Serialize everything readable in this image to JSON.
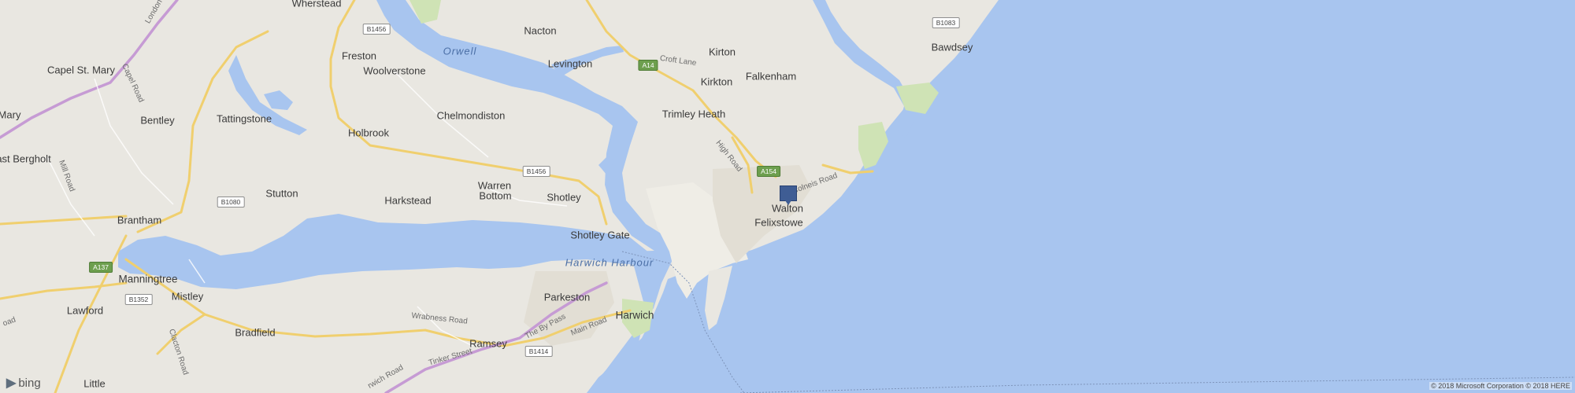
{
  "map": {
    "colors": {
      "land": "#e9e7e1",
      "water": "#a8c5ef",
      "main_road": "#f0cf6e",
      "trunk_road": "#c69bd4",
      "park": "#cfe3b5",
      "port": "#efede6",
      "marker": "#3f5d94"
    },
    "places": [
      {
        "id": "wherstead",
        "name": "Wherstead"
      },
      {
        "id": "nacton",
        "name": "Nacton"
      },
      {
        "id": "kirton",
        "name": "Kirton"
      },
      {
        "id": "bawdsey",
        "name": "Bawdsey"
      },
      {
        "id": "capel-st-mary",
        "name": "Capel St. Mary"
      },
      {
        "id": "freston",
        "name": "Freston"
      },
      {
        "id": "woolverstone",
        "name": "Woolverstone"
      },
      {
        "id": "levington",
        "name": "Levington"
      },
      {
        "id": "kirkton",
        "name": "Kirkton"
      },
      {
        "id": "falkenham",
        "name": "Falkenham"
      },
      {
        "id": "mary",
        "name": "Mary"
      },
      {
        "id": "tattingstone",
        "name": "Tattingstone"
      },
      {
        "id": "chelmondiston",
        "name": "Chelmondiston"
      },
      {
        "id": "trimley-heath",
        "name": "Trimley Heath"
      },
      {
        "id": "bentley",
        "name": "Bentley"
      },
      {
        "id": "holbrook",
        "name": "Holbrook"
      },
      {
        "id": "east-bergholt",
        "name": "ast Bergholt"
      },
      {
        "id": "stutton",
        "name": "Stutton"
      },
      {
        "id": "warren-bottom-1",
        "name": "Warren"
      },
      {
        "id": "warren-bottom-2",
        "name": "Bottom"
      },
      {
        "id": "harkstead",
        "name": "Harkstead"
      },
      {
        "id": "shotley",
        "name": "Shotley"
      },
      {
        "id": "walton",
        "name": "Walton"
      },
      {
        "id": "felixstowe",
        "name": "Felixstowe"
      },
      {
        "id": "brantham",
        "name": "Brantham"
      },
      {
        "id": "shotley-gate",
        "name": "Shotley Gate"
      },
      {
        "id": "manningtree",
        "name": "Manningtree"
      },
      {
        "id": "parkeston",
        "name": "Parkeston"
      },
      {
        "id": "mistley",
        "name": "Mistley"
      },
      {
        "id": "lawford",
        "name": "Lawford"
      },
      {
        "id": "harwich",
        "name": "Harwich"
      },
      {
        "id": "bradfield",
        "name": "Bradfield"
      },
      {
        "id": "ramsey",
        "name": "Ramsey"
      },
      {
        "id": "little-bromley",
        "name": "Little"
      }
    ],
    "water_labels": [
      {
        "id": "orwell",
        "name": "Orwell"
      },
      {
        "id": "harwich-harbour",
        "name": "Harwich Harbour"
      }
    ],
    "street_labels": [
      {
        "id": "london-road",
        "name": "London"
      },
      {
        "id": "capel-road",
        "name": "Capel Road"
      },
      {
        "id": "mill-road",
        "name": "Mill Road"
      },
      {
        "id": "croft-lane",
        "name": "Croft Lane"
      },
      {
        "id": "high-road",
        "name": "High Road"
      },
      {
        "id": "colneis-road",
        "name": "Colneis Road"
      },
      {
        "id": "wrabness-road",
        "name": "Wrabness Road"
      },
      {
        "id": "the-by-pass",
        "name": "The By Pass"
      },
      {
        "id": "main-road",
        "name": "Main Road"
      },
      {
        "id": "tinker-street",
        "name": "Tinker Street"
      },
      {
        "id": "harwich-road",
        "name": "rwich Road"
      },
      {
        "id": "clacton-road",
        "name": "Clacton Road"
      },
      {
        "id": "road-left",
        "name": "oad"
      }
    ],
    "road_shields": [
      {
        "id": "b1456-top",
        "name": "B1456"
      },
      {
        "id": "b1083",
        "name": "B1083"
      },
      {
        "id": "a14",
        "name": "A14"
      },
      {
        "id": "b1456-mid",
        "name": "B1456"
      },
      {
        "id": "a154",
        "name": "A154"
      },
      {
        "id": "b1080",
        "name": "B1080"
      },
      {
        "id": "a137",
        "name": "A137"
      },
      {
        "id": "b1352",
        "name": "B1352"
      },
      {
        "id": "b1414",
        "name": "B1414"
      }
    ],
    "marker": {
      "label": "Walton"
    },
    "branding": {
      "logo_text": "bing"
    },
    "copyright": "© 2018 Microsoft Corporation © 2018 HERE"
  }
}
